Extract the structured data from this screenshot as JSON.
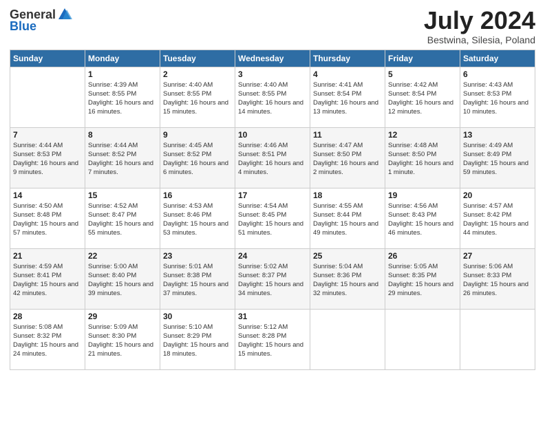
{
  "header": {
    "logo_general": "General",
    "logo_blue": "Blue",
    "main_title": "July 2024",
    "subtitle": "Bestwina, Silesia, Poland"
  },
  "calendar": {
    "headers": [
      "Sunday",
      "Monday",
      "Tuesday",
      "Wednesday",
      "Thursday",
      "Friday",
      "Saturday"
    ],
    "weeks": [
      [
        {
          "day": "",
          "sunrise": "",
          "sunset": "",
          "daylight": ""
        },
        {
          "day": "1",
          "sunrise": "Sunrise: 4:39 AM",
          "sunset": "Sunset: 8:55 PM",
          "daylight": "Daylight: 16 hours and 16 minutes."
        },
        {
          "day": "2",
          "sunrise": "Sunrise: 4:40 AM",
          "sunset": "Sunset: 8:55 PM",
          "daylight": "Daylight: 16 hours and 15 minutes."
        },
        {
          "day": "3",
          "sunrise": "Sunrise: 4:40 AM",
          "sunset": "Sunset: 8:55 PM",
          "daylight": "Daylight: 16 hours and 14 minutes."
        },
        {
          "day": "4",
          "sunrise": "Sunrise: 4:41 AM",
          "sunset": "Sunset: 8:54 PM",
          "daylight": "Daylight: 16 hours and 13 minutes."
        },
        {
          "day": "5",
          "sunrise": "Sunrise: 4:42 AM",
          "sunset": "Sunset: 8:54 PM",
          "daylight": "Daylight: 16 hours and 12 minutes."
        },
        {
          "day": "6",
          "sunrise": "Sunrise: 4:43 AM",
          "sunset": "Sunset: 8:53 PM",
          "daylight": "Daylight: 16 hours and 10 minutes."
        }
      ],
      [
        {
          "day": "7",
          "sunrise": "Sunrise: 4:44 AM",
          "sunset": "Sunset: 8:53 PM",
          "daylight": "Daylight: 16 hours and 9 minutes."
        },
        {
          "day": "8",
          "sunrise": "Sunrise: 4:44 AM",
          "sunset": "Sunset: 8:52 PM",
          "daylight": "Daylight: 16 hours and 7 minutes."
        },
        {
          "day": "9",
          "sunrise": "Sunrise: 4:45 AM",
          "sunset": "Sunset: 8:52 PM",
          "daylight": "Daylight: 16 hours and 6 minutes."
        },
        {
          "day": "10",
          "sunrise": "Sunrise: 4:46 AM",
          "sunset": "Sunset: 8:51 PM",
          "daylight": "Daylight: 16 hours and 4 minutes."
        },
        {
          "day": "11",
          "sunrise": "Sunrise: 4:47 AM",
          "sunset": "Sunset: 8:50 PM",
          "daylight": "Daylight: 16 hours and 2 minutes."
        },
        {
          "day": "12",
          "sunrise": "Sunrise: 4:48 AM",
          "sunset": "Sunset: 8:50 PM",
          "daylight": "Daylight: 16 hours and 1 minute."
        },
        {
          "day": "13",
          "sunrise": "Sunrise: 4:49 AM",
          "sunset": "Sunset: 8:49 PM",
          "daylight": "Daylight: 15 hours and 59 minutes."
        }
      ],
      [
        {
          "day": "14",
          "sunrise": "Sunrise: 4:50 AM",
          "sunset": "Sunset: 8:48 PM",
          "daylight": "Daylight: 15 hours and 57 minutes."
        },
        {
          "day": "15",
          "sunrise": "Sunrise: 4:52 AM",
          "sunset": "Sunset: 8:47 PM",
          "daylight": "Daylight: 15 hours and 55 minutes."
        },
        {
          "day": "16",
          "sunrise": "Sunrise: 4:53 AM",
          "sunset": "Sunset: 8:46 PM",
          "daylight": "Daylight: 15 hours and 53 minutes."
        },
        {
          "day": "17",
          "sunrise": "Sunrise: 4:54 AM",
          "sunset": "Sunset: 8:45 PM",
          "daylight": "Daylight: 15 hours and 51 minutes."
        },
        {
          "day": "18",
          "sunrise": "Sunrise: 4:55 AM",
          "sunset": "Sunset: 8:44 PM",
          "daylight": "Daylight: 15 hours and 49 minutes."
        },
        {
          "day": "19",
          "sunrise": "Sunrise: 4:56 AM",
          "sunset": "Sunset: 8:43 PM",
          "daylight": "Daylight: 15 hours and 46 minutes."
        },
        {
          "day": "20",
          "sunrise": "Sunrise: 4:57 AM",
          "sunset": "Sunset: 8:42 PM",
          "daylight": "Daylight: 15 hours and 44 minutes."
        }
      ],
      [
        {
          "day": "21",
          "sunrise": "Sunrise: 4:59 AM",
          "sunset": "Sunset: 8:41 PM",
          "daylight": "Daylight: 15 hours and 42 minutes."
        },
        {
          "day": "22",
          "sunrise": "Sunrise: 5:00 AM",
          "sunset": "Sunset: 8:40 PM",
          "daylight": "Daylight: 15 hours and 39 minutes."
        },
        {
          "day": "23",
          "sunrise": "Sunrise: 5:01 AM",
          "sunset": "Sunset: 8:38 PM",
          "daylight": "Daylight: 15 hours and 37 minutes."
        },
        {
          "day": "24",
          "sunrise": "Sunrise: 5:02 AM",
          "sunset": "Sunset: 8:37 PM",
          "daylight": "Daylight: 15 hours and 34 minutes."
        },
        {
          "day": "25",
          "sunrise": "Sunrise: 5:04 AM",
          "sunset": "Sunset: 8:36 PM",
          "daylight": "Daylight: 15 hours and 32 minutes."
        },
        {
          "day": "26",
          "sunrise": "Sunrise: 5:05 AM",
          "sunset": "Sunset: 8:35 PM",
          "daylight": "Daylight: 15 hours and 29 minutes."
        },
        {
          "day": "27",
          "sunrise": "Sunrise: 5:06 AM",
          "sunset": "Sunset: 8:33 PM",
          "daylight": "Daylight: 15 hours and 26 minutes."
        }
      ],
      [
        {
          "day": "28",
          "sunrise": "Sunrise: 5:08 AM",
          "sunset": "Sunset: 8:32 PM",
          "daylight": "Daylight: 15 hours and 24 minutes."
        },
        {
          "day": "29",
          "sunrise": "Sunrise: 5:09 AM",
          "sunset": "Sunset: 8:30 PM",
          "daylight": "Daylight: 15 hours and 21 minutes."
        },
        {
          "day": "30",
          "sunrise": "Sunrise: 5:10 AM",
          "sunset": "Sunset: 8:29 PM",
          "daylight": "Daylight: 15 hours and 18 minutes."
        },
        {
          "day": "31",
          "sunrise": "Sunrise: 5:12 AM",
          "sunset": "Sunset: 8:28 PM",
          "daylight": "Daylight: 15 hours and 15 minutes."
        },
        {
          "day": "",
          "sunrise": "",
          "sunset": "",
          "daylight": ""
        },
        {
          "day": "",
          "sunrise": "",
          "sunset": "",
          "daylight": ""
        },
        {
          "day": "",
          "sunrise": "",
          "sunset": "",
          "daylight": ""
        }
      ]
    ]
  }
}
